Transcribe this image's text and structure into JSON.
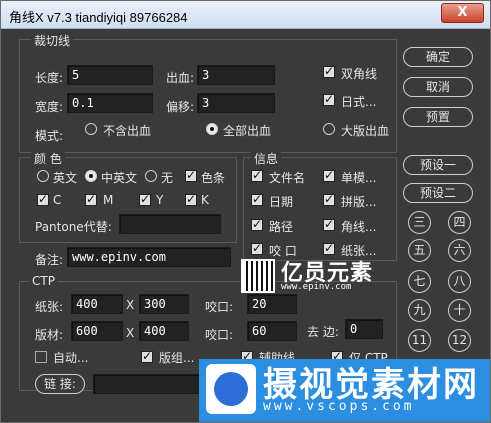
{
  "window": {
    "title": "角线X v7.3 tiandiyiqi 89766284",
    "close": "X"
  },
  "cut": {
    "section_title": "裁切线",
    "length_label": "长度:",
    "length_value": "5",
    "width_label": "宽度:",
    "width_value": "0.1",
    "bleed_label": "出血:",
    "bleed_value": "3",
    "offset_label": "偏移:",
    "offset_value": "3",
    "double_corner": "双角线",
    "japanese": "日式...",
    "mode_label": "模式:",
    "modes": [
      "不含出血",
      "全部出血",
      "大版出血"
    ]
  },
  "color": {
    "section_title": "颜  色",
    "lang_options": [
      "英文",
      "中英文",
      "无"
    ],
    "color_bar": "色条",
    "cmyk": [
      "C",
      "M",
      "Y",
      "K"
    ],
    "pantone_label": "Pantone代替:"
  },
  "info": {
    "section_title": "信息",
    "items": [
      "文件名",
      "单模...",
      "日期",
      "拼版...",
      "路径",
      "角线...",
      "咬  口",
      "纸张..."
    ]
  },
  "note": {
    "label": "备注:",
    "value": "www.epinv.com"
  },
  "ctp": {
    "section_title": "CTP",
    "paper_label": "纸张:",
    "paper_w": "400",
    "x1": "X",
    "paper_h": "300",
    "bite_label": "咬口:",
    "bite_value": "20",
    "plate_label": "版材:",
    "plate_w": "600",
    "x2": "X",
    "plate_h": "400",
    "bite2_label": "咬口:",
    "bite2_value": "60",
    "trim_label": "去 边:",
    "trim_value": "0",
    "auto": "自动...",
    "plate_grp": "版组...",
    "guides": "辅助线",
    "only_ctp": "仅 CTP",
    "link_label": "链 接:"
  },
  "buttons": {
    "ok": "确定",
    "cancel": "取消",
    "preset": "预置",
    "preset1": "预设一",
    "preset2": "预设二"
  },
  "circles": [
    "三",
    "四",
    "五",
    "六",
    "七",
    "八",
    "九",
    "十",
    "11",
    "12"
  ],
  "overlay": {
    "brand": "亿员元素",
    "brand_url": "www.epinv.com",
    "wm_title": "摄视觉素材网",
    "wm_url": "www.vscops.com"
  }
}
